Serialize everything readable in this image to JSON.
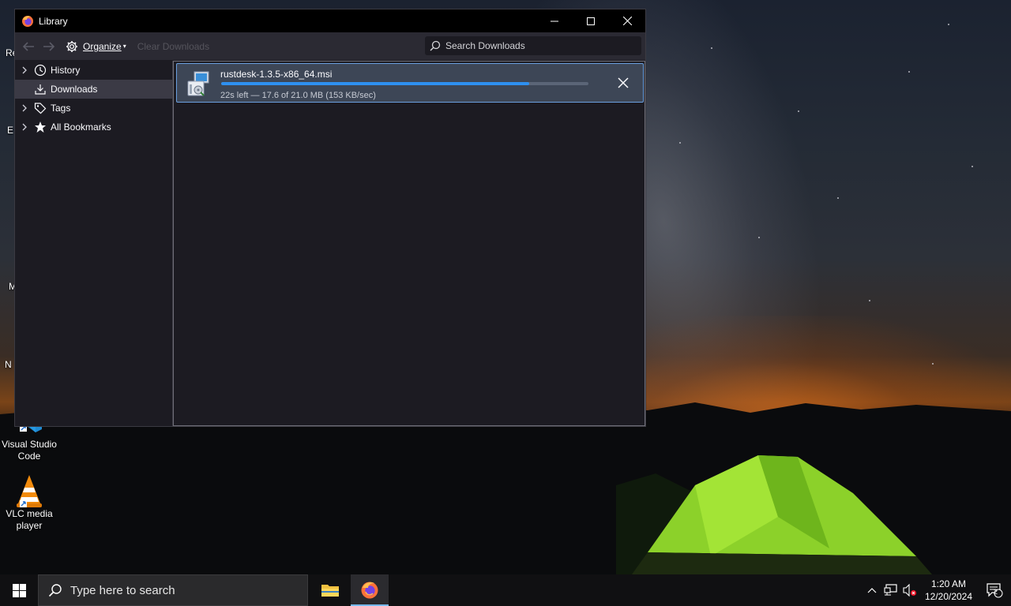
{
  "window": {
    "title": "Library",
    "controls": [
      "minimize",
      "maximize",
      "close"
    ]
  },
  "toolbar": {
    "organize_label": "Organize",
    "clear_downloads_label": "Clear Downloads",
    "search_placeholder": "Search Downloads"
  },
  "sidebar": {
    "items": [
      {
        "label": "History",
        "icon": "clock-icon",
        "expandable": true
      },
      {
        "label": "Downloads",
        "icon": "download-icon",
        "expandable": false,
        "selected": true
      },
      {
        "label": "Tags",
        "icon": "tag-icon",
        "expandable": true
      },
      {
        "label": "All Bookmarks",
        "icon": "star-icon",
        "expandable": true
      }
    ]
  },
  "downloads": [
    {
      "filename": "rustdesk-1.3.5-x86_64.msi",
      "status": "22s left — 17.6 of 21.0 MB (153 KB/sec)",
      "progress_fraction": 0.838
    }
  ],
  "desktop": {
    "icons": [
      {
        "label": "Visual Studio Code",
        "icon": "vscode-icon"
      },
      {
        "label": "VLC media player",
        "icon": "vlc-icon"
      }
    ],
    "partial_labels": [
      "Re",
      "E",
      "M",
      "N"
    ]
  },
  "taskbar": {
    "search_placeholder": "Type here to search",
    "apps": [
      "file-explorer-icon",
      "firefox-icon"
    ],
    "time": "1:20 AM",
    "date": "12/20/2024",
    "notification_count": "2"
  },
  "colors": {
    "accent": "#2e90f0",
    "row_selected": "#3d4656",
    "window_bg": "#1c1b22"
  }
}
